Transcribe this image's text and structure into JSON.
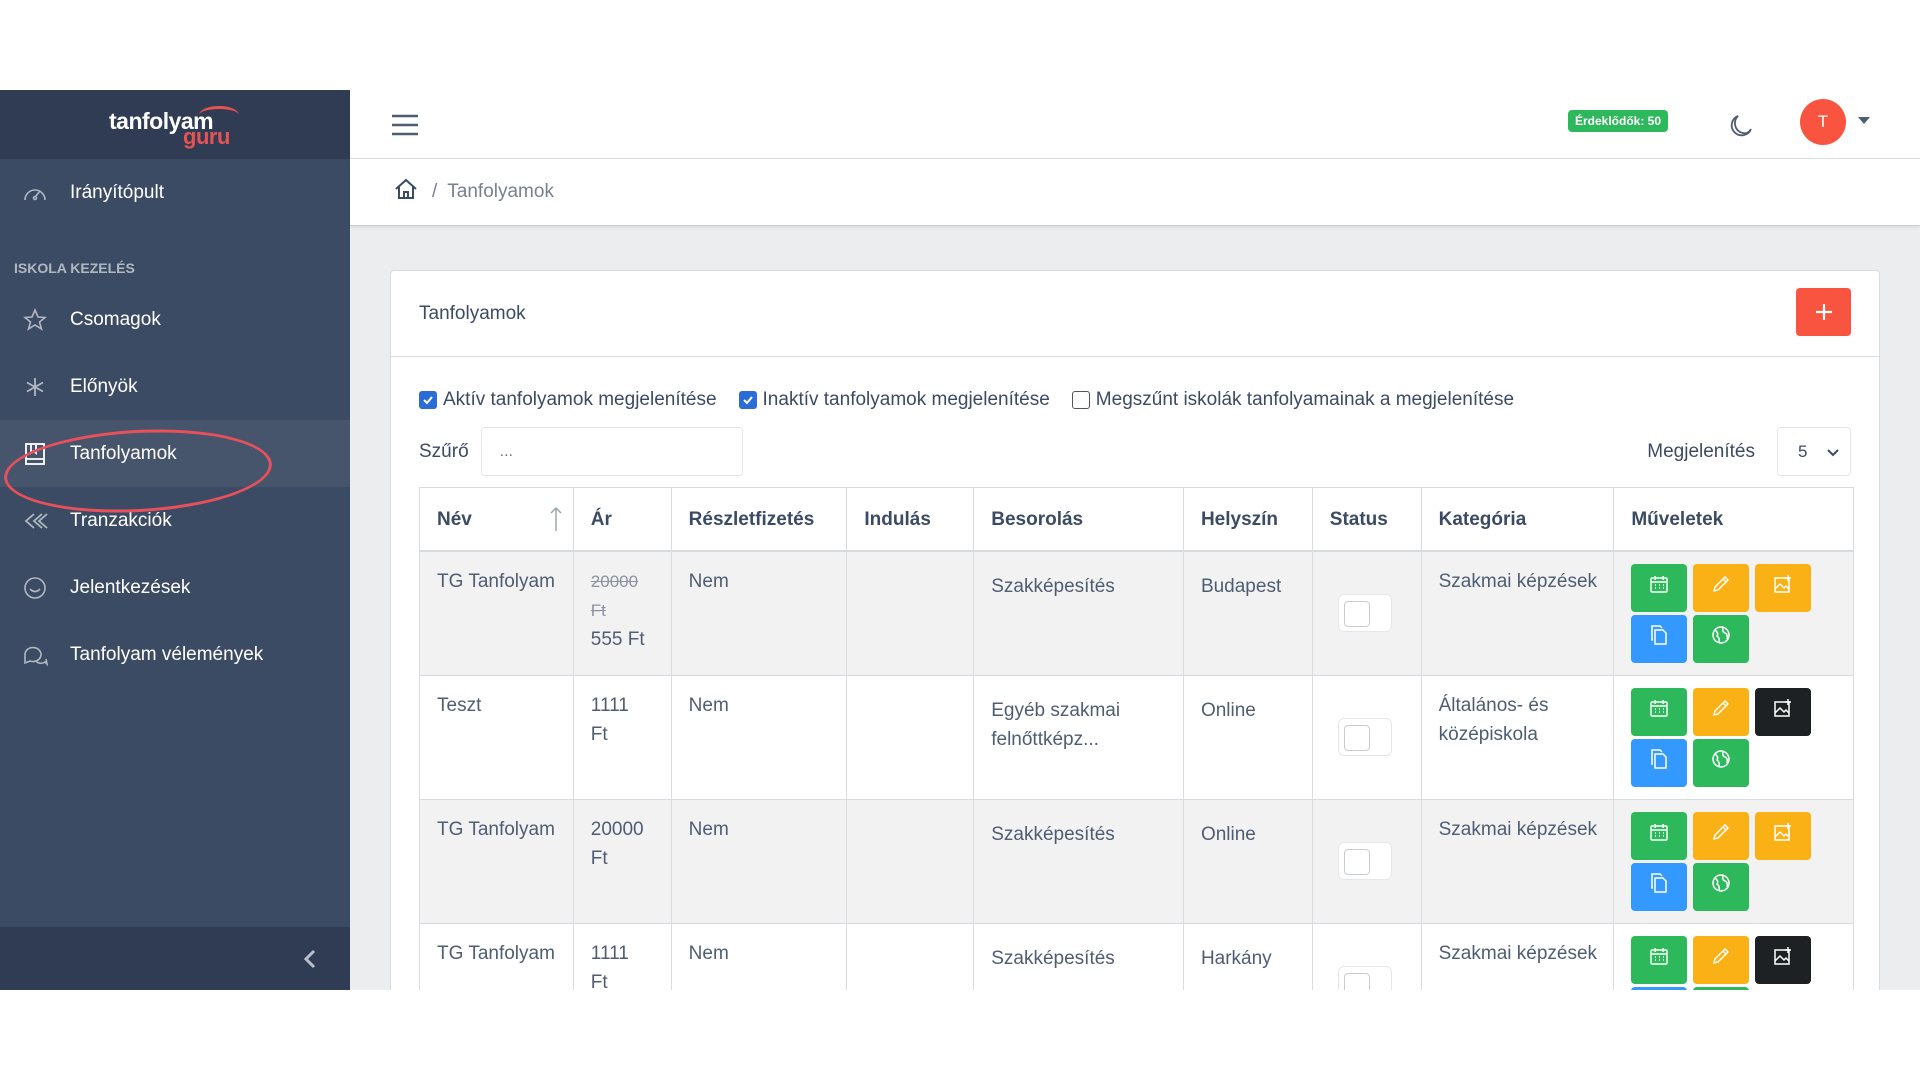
{
  "sidebar": {
    "brand_top": "tanfolyam",
    "brand_bottom": "guru",
    "dashboard": "Irányítópult",
    "section_title": "ISKOLA KEZELÉS",
    "items": [
      "Csomagok",
      "Előnyök",
      "Tanfolyamok",
      "Tranzakciók",
      "Jelentkezések",
      "Tanfolyam vélemények"
    ]
  },
  "header": {
    "badge": "Érdeklődők: 50",
    "avatar_initial": "T"
  },
  "breadcrumb": {
    "separator": "/",
    "current": "Tanfolyamok"
  },
  "card": {
    "title": "Tanfolyamok",
    "filters": [
      {
        "label": "Aktív tanfolyamok megjelenítése",
        "checked": true
      },
      {
        "label": "Inaktív tanfolyamok megjelenítése",
        "checked": true
      },
      {
        "label": "Megszűnt iskolák tanfolyamainak a megjelenítése",
        "checked": false
      }
    ],
    "search_label": "Szűrő",
    "search_placeholder": "...",
    "show_label": "Megjelenítés",
    "show_value": "5"
  },
  "table": {
    "headers": [
      "Név",
      "Ár",
      "Részletfizetés",
      "Indulás",
      "Besorolás",
      "Helyszín",
      "Status",
      "Kategória",
      "Műveletek"
    ],
    "rows": [
      {
        "name": "TG Tanfolyam",
        "price_old_1": "20000",
        "price_old_2": "Ft",
        "price_1": "555 Ft",
        "price_2": "",
        "installment": "Nem",
        "start": "",
        "class_1": "Szakképesítés",
        "class_2": "",
        "location": "Budapest",
        "cat_1": "Szakmai képzések",
        "cat_2": "",
        "image_btn": "yellow"
      },
      {
        "name": "Teszt",
        "price_old_1": "",
        "price_old_2": "",
        "price_1": "1111",
        "price_2": "Ft",
        "installment": "Nem",
        "start": "",
        "class_1": "Egyéb szakmai",
        "class_2": "felnőttképz...",
        "location": "Online",
        "cat_1": "Általános- és",
        "cat_2": "középiskola",
        "image_btn": "dark"
      },
      {
        "name": "TG Tanfolyam",
        "price_old_1": "",
        "price_old_2": "",
        "price_1": "20000",
        "price_2": "Ft",
        "installment": "Nem",
        "start": "",
        "class_1": "Szakképesítés",
        "class_2": "",
        "location": "Online",
        "cat_1": "Szakmai képzések",
        "cat_2": "",
        "image_btn": "yellow"
      },
      {
        "name": "TG Tanfolyam",
        "price_old_1": "",
        "price_old_2": "",
        "price_1": "1111",
        "price_2": "Ft",
        "installment": "Nem",
        "start": "",
        "class_1": "Szakképesítés",
        "class_2": "",
        "location": "Harkány",
        "cat_1": "Szakmai képzések",
        "cat_2": "",
        "image_btn": "dark"
      }
    ]
  },
  "icons": {
    "dashboard": "speedometer-icon",
    "packages": "star-icon",
    "benefits": "asterisk-icon",
    "courses": "book-icon",
    "transactions": "double-chevron-left-icon",
    "applications": "smile-icon",
    "reviews": "chat-bubbles-icon",
    "menu": "hamburger-icon",
    "theme": "moon-icon",
    "home": "home-icon"
  },
  "colors": {
    "sidebar": "#3c4b64",
    "danger": "#f9543f",
    "success": "#2eb85c",
    "warning": "#f9b115",
    "info": "#3399ff",
    "dark": "#1e2124"
  }
}
